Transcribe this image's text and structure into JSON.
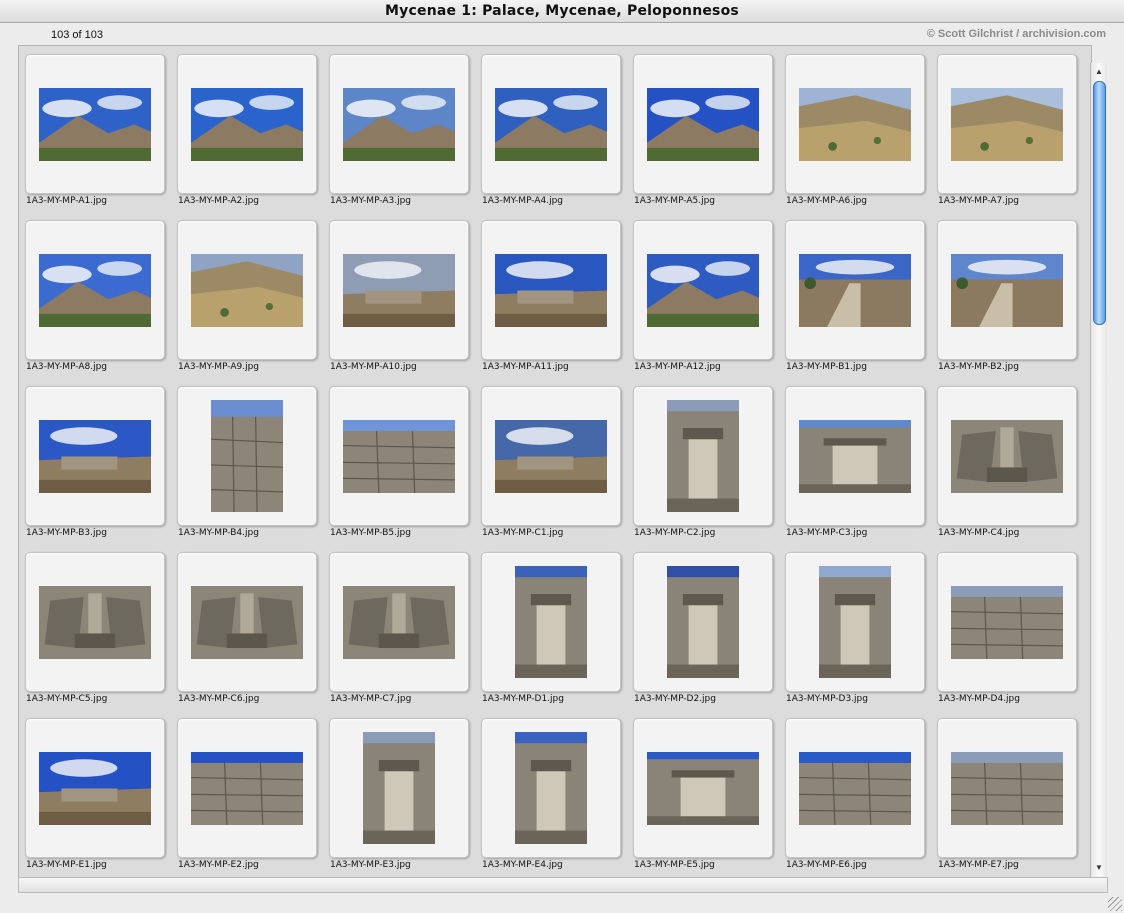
{
  "window": {
    "title": "Mycenae 1: Palace, Mycenae, Peloponnesos",
    "count": "103 of 103",
    "copyright": "© Scott Gilchrist / archivision.com"
  },
  "icons": {
    "scroll_up": "▲",
    "scroll_down": "▼"
  },
  "thumbnails": [
    {
      "filename": "1A3-MY-MP-A1.jpg",
      "orientation": "landscape",
      "scene": "mountain",
      "sky": "#2f62c8"
    },
    {
      "filename": "1A3-MY-MP-A2.jpg",
      "orientation": "landscape",
      "scene": "mountain",
      "sky": "#2a63cc"
    },
    {
      "filename": "1A3-MY-MP-A3.jpg",
      "orientation": "landscape",
      "scene": "mountain",
      "sky": "#5c86c8"
    },
    {
      "filename": "1A3-MY-MP-A4.jpg",
      "orientation": "landscape",
      "scene": "mountain",
      "sky": "#2f60c0"
    },
    {
      "filename": "1A3-MY-MP-A5.jpg",
      "orientation": "landscape",
      "scene": "mountain",
      "sky": "#2452c4"
    },
    {
      "filename": "1A3-MY-MP-A6.jpg",
      "orientation": "landscape",
      "scene": "hillside",
      "sky": "#9fb4d4"
    },
    {
      "filename": "1A3-MY-MP-A7.jpg",
      "orientation": "landscape",
      "scene": "hillside",
      "sky": "#a9bfdc"
    },
    {
      "filename": "1A3-MY-MP-A8.jpg",
      "orientation": "landscape",
      "scene": "mountain",
      "sky": "#3b6bd0"
    },
    {
      "filename": "1A3-MY-MP-A9.jpg",
      "orientation": "landscape",
      "scene": "hillside",
      "sky": "#8fa4c4"
    },
    {
      "filename": "1A3-MY-MP-A10.jpg",
      "orientation": "landscape",
      "scene": "ruins",
      "sky": "#8f9db4"
    },
    {
      "filename": "1A3-MY-MP-A11.jpg",
      "orientation": "landscape",
      "scene": "ruins",
      "sky": "#2a56c0"
    },
    {
      "filename": "1A3-MY-MP-A12.jpg",
      "orientation": "landscape",
      "scene": "mountain",
      "sky": "#2e5bc2"
    },
    {
      "filename": "1A3-MY-MP-B1.jpg",
      "orientation": "landscape",
      "scene": "path",
      "sky": "#3b66c8"
    },
    {
      "filename": "1A3-MY-MP-B2.jpg",
      "orientation": "landscape",
      "scene": "path",
      "sky": "#5f86cc"
    },
    {
      "filename": "1A3-MY-MP-B3.jpg",
      "orientation": "landscape",
      "scene": "ruins",
      "sky": "#2b58c4"
    },
    {
      "filename": "1A3-MY-MP-B4.jpg",
      "orientation": "portrait",
      "scene": "wall",
      "sky": "#6a8ed0"
    },
    {
      "filename": "1A3-MY-MP-B5.jpg",
      "orientation": "landscape",
      "scene": "wall",
      "sky": "#6d95d8"
    },
    {
      "filename": "1A3-MY-MP-C1.jpg",
      "orientation": "landscape",
      "scene": "ruins",
      "sky": "#4668a8"
    },
    {
      "filename": "1A3-MY-MP-C2.jpg",
      "orientation": "portrait",
      "scene": "gate",
      "sky": "#8a9cb8"
    },
    {
      "filename": "1A3-MY-MP-C3.jpg",
      "orientation": "landscape",
      "scene": "gate",
      "sky": "#6088cc"
    },
    {
      "filename": "1A3-MY-MP-C4.jpg",
      "orientation": "landscape",
      "scene": "relief",
      "sky": "#8a9cb8"
    },
    {
      "filename": "1A3-MY-MP-C5.jpg",
      "orientation": "landscape",
      "scene": "relief",
      "sky": "#8a9cb8"
    },
    {
      "filename": "1A3-MY-MP-C6.jpg",
      "orientation": "landscape",
      "scene": "relief",
      "sky": "#8a9cb8"
    },
    {
      "filename": "1A3-MY-MP-C7.jpg",
      "orientation": "landscape",
      "scene": "relief",
      "sky": "#86a4d8"
    },
    {
      "filename": "1A3-MY-MP-D1.jpg",
      "orientation": "portrait",
      "scene": "gate",
      "sky": "#3a62b8"
    },
    {
      "filename": "1A3-MY-MP-D2.jpg",
      "orientation": "portrait",
      "scene": "gate",
      "sky": "#3050a8"
    },
    {
      "filename": "1A3-MY-MP-D3.jpg",
      "orientation": "portrait",
      "scene": "gate",
      "sky": "#8fa8d0"
    },
    {
      "filename": "1A3-MY-MP-D4.jpg",
      "orientation": "landscape",
      "scene": "wall",
      "sky": "#8a9cb8"
    },
    {
      "filename": "1A3-MY-MP-E1.jpg",
      "orientation": "landscape",
      "scene": "ruins",
      "sky": "#2452c4"
    },
    {
      "filename": "1A3-MY-MP-E2.jpg",
      "orientation": "landscape",
      "scene": "wall",
      "sky": "#2452c4"
    },
    {
      "filename": "1A3-MY-MP-E3.jpg",
      "orientation": "portrait",
      "scene": "gate",
      "sky": "#8a9cb8"
    },
    {
      "filename": "1A3-MY-MP-E4.jpg",
      "orientation": "portrait",
      "scene": "gate",
      "sky": "#3a62c0"
    },
    {
      "filename": "1A3-MY-MP-E5.jpg",
      "orientation": "landscape",
      "scene": "gate",
      "sky": "#2a5ac8"
    },
    {
      "filename": "1A3-MY-MP-E6.jpg",
      "orientation": "landscape",
      "scene": "wall",
      "sky": "#2a5ac8"
    },
    {
      "filename": "1A3-MY-MP-E7.jpg",
      "orientation": "landscape",
      "scene": "wall",
      "sky": "#8a9cb8"
    }
  ]
}
